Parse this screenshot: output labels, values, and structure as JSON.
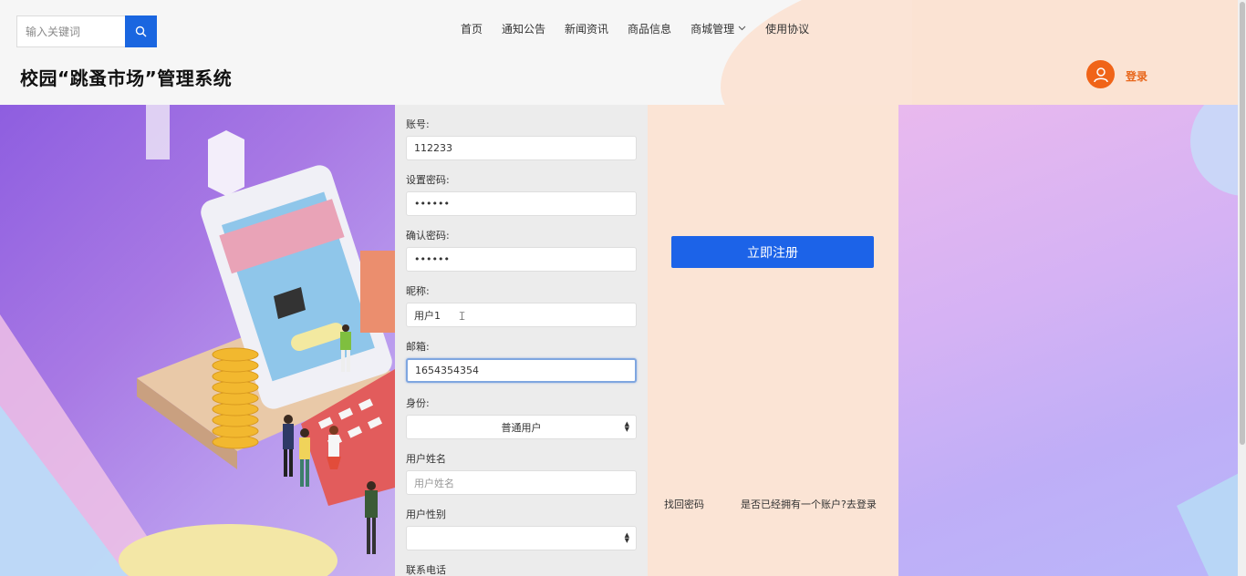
{
  "header": {
    "search": {
      "placeholder": "输入关键词"
    },
    "nav": [
      {
        "label": "首页"
      },
      {
        "label": "通知公告"
      },
      {
        "label": "新闻资讯"
      },
      {
        "label": "商品信息"
      },
      {
        "label": "商城管理",
        "has_dropdown": true
      },
      {
        "label": "使用协议"
      }
    ],
    "site_title": "校园“跳蚤市场”管理系统",
    "login_label": "登录"
  },
  "form": {
    "fields": [
      {
        "label": "账号:",
        "value": "112233"
      },
      {
        "label": "设置密码:",
        "value": "••••••"
      },
      {
        "label": "确认密码:",
        "value": "••••••"
      },
      {
        "label": "昵称:",
        "value": "用户1"
      },
      {
        "label": "邮箱:",
        "value": "1654354354"
      },
      {
        "label": "身份:",
        "value": "普通用户"
      },
      {
        "label": "用户姓名",
        "placeholder": "用户姓名"
      },
      {
        "label": "用户性别",
        "value": ""
      },
      {
        "label": "联系电话"
      }
    ]
  },
  "actions": {
    "register_label": "立即注册",
    "forgot_password": "找回密码",
    "has_account": "是否已经拥有一个账户?去登录"
  },
  "colors": {
    "primary": "#1c63e8",
    "accent_orange": "#f06418",
    "panel_peach": "#fbe4d5"
  }
}
